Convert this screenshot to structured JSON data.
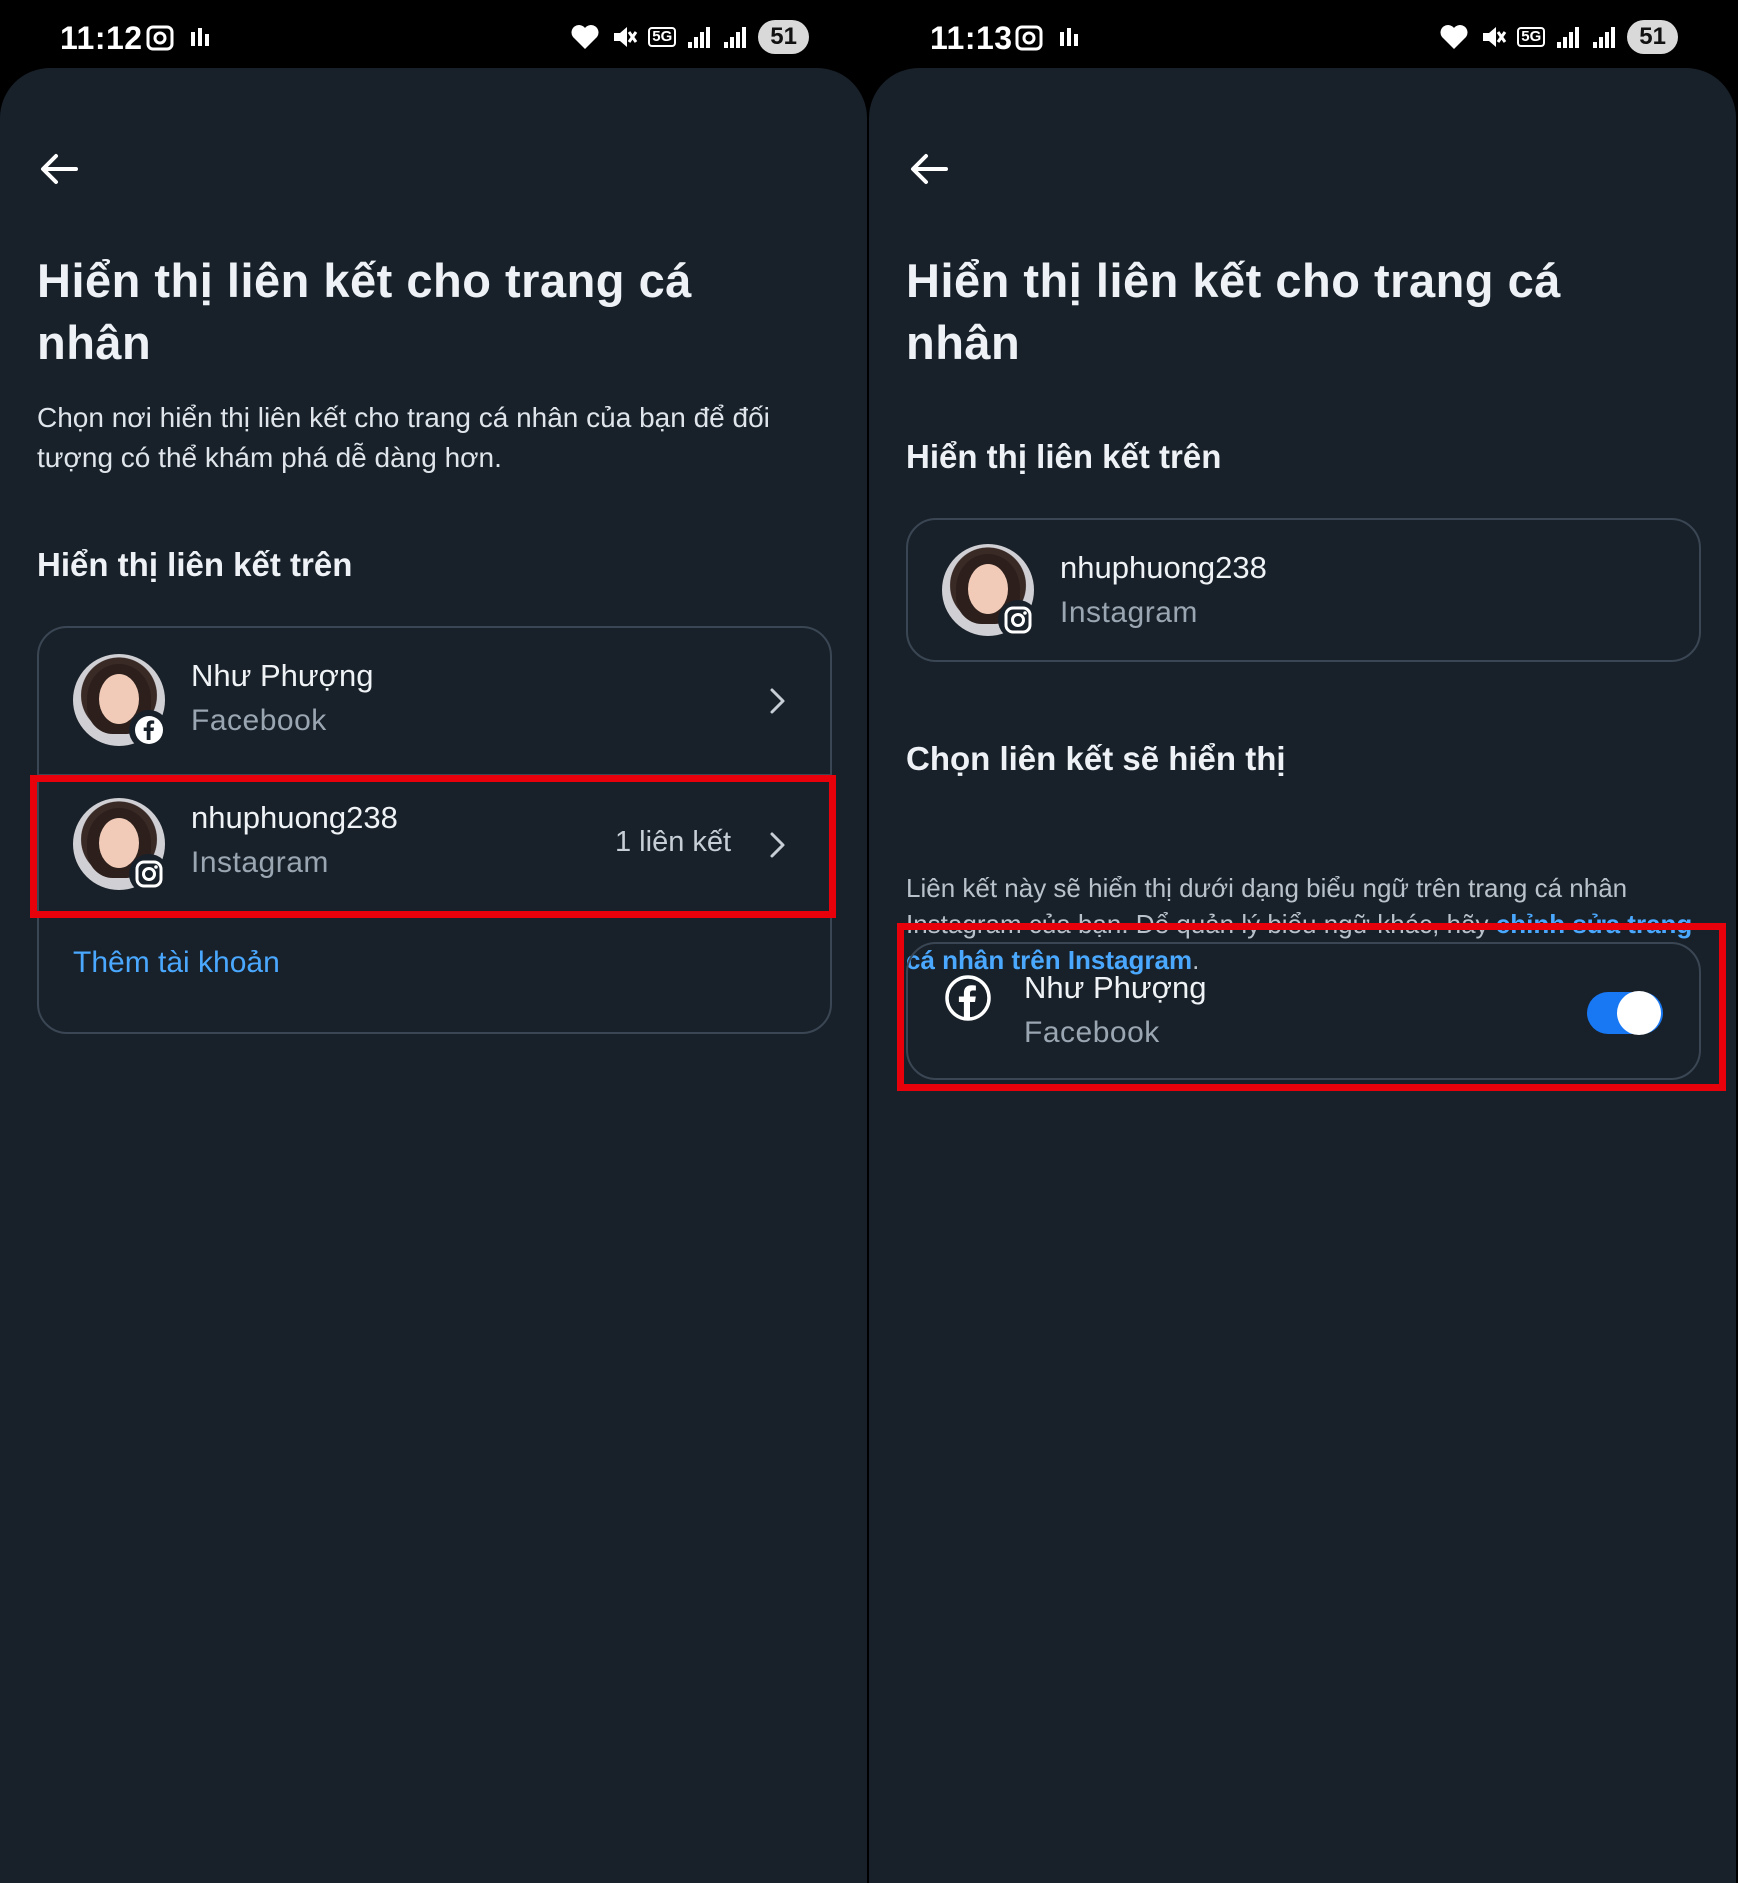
{
  "left": {
    "status": {
      "time": "11:12",
      "battery": "51",
      "network": "5G"
    },
    "title": "Hiển thị liên kết cho trang cá nhân",
    "subtitle": "Chọn nơi hiển thị liên kết cho trang cá nhân của bạn để đối tượng có thể khám phá dễ dàng hơn.",
    "section_heading": "Hiển thị liên kết trên",
    "accounts": [
      {
        "name": "Như Phượng",
        "platform": "Facebook",
        "meta": "",
        "icon": "facebook-icon"
      },
      {
        "name": "nhuphuong238",
        "platform": "Instagram",
        "meta": "1 liên kết",
        "icon": "instagram-icon"
      }
    ],
    "add_account_label": "Thêm tài khoản"
  },
  "right": {
    "status": {
      "time": "11:13",
      "battery": "51",
      "network": "5G"
    },
    "title": "Hiển thị liên kết cho trang cá nhân",
    "section_heading": "Hiển thị liên kết trên",
    "account": {
      "name": "nhuphuong238",
      "platform": "Instagram",
      "icon": "instagram-icon"
    },
    "choose_heading": "Chọn liên kết sẽ hiển thị",
    "desc_text": "Liên kết này sẽ hiển thị dưới dạng biểu ngữ trên trang cá nhân Instagram của bạn. Để quản lý biểu ngữ khác, hãy ",
    "desc_link": "chỉnh sửa trang cá nhân trên Instagram",
    "desc_end": ".",
    "link_option": {
      "name": "Như Phượng",
      "platform": "Facebook",
      "icon": "facebook-icon",
      "enabled": true
    }
  },
  "colors": {
    "background": "#18212a",
    "accent": "#1877f2",
    "link": "#4aa8ff",
    "highlight": "#e8000b"
  }
}
